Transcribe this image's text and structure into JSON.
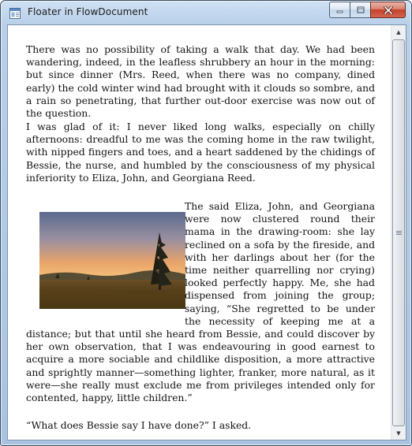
{
  "window": {
    "title": "Floater in FlowDocument",
    "icons": {
      "app": "wpf-window-icon",
      "minimize": "minimize-icon",
      "maximize": "maximize-icon",
      "close": "close-icon"
    }
  },
  "document": {
    "paragraphs": [
      "There was no possibility of taking a walk that day. We had been wandering, indeed, in the leafless shrubbery an hour in the morning: but since dinner (Mrs. Reed, when there was no company, dined early) the cold winter wind had brought with it clouds so sombre, and a rain so penetrating, that further out-door exercise was now out of the question.",
      "I was glad of it: I never liked long walks, especially on chilly afternoons: dreadful to me was the coming home in the raw twilight, with nipped fingers and toes, and a heart saddened by the chidings of Bessie, the nurse, and humbled by the consciousness of my physical inferiority to Eliza, John, and Georgiana Reed.",
      " The said Eliza, John, and Georgiana were now clustered round their mama in the drawing-room: she lay reclined on a sofa by the fireside, and with her darlings about her (for the time neither quarrelling nor crying) looked perfectly happy. Me, she had dispensed from joining the group; saying, “She regretted to be under the necessity of keeping me at a distance; but that until she heard from Bessie, and could discover by her own observation, that I was endeavouring in good earnest to acquire a more sociable and childlike disposition, a more attractive and sprightly manner—something lighter, franker, more natural, as it were—she really must exclude me from privileges intended only for contented, happy, little children.”",
      "“What does Bessie say I have done?” I asked."
    ],
    "floater_image": "landscape-photo-with-fir-tree"
  },
  "scrollbar": {
    "thumb_fraction": 0.98
  },
  "colors": {
    "frame": "#b9d0ea",
    "close_button": "#c5402a"
  }
}
